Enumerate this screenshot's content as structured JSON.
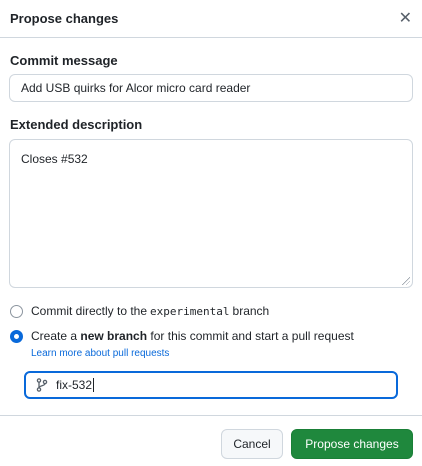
{
  "dialog": {
    "title": "Propose changes",
    "close_icon": "close-icon"
  },
  "commit": {
    "label": "Commit message",
    "value": "Add USB quirks for Alcor micro card reader"
  },
  "description": {
    "label": "Extended description",
    "value": "Closes #532"
  },
  "options": {
    "direct": {
      "prefix": "Commit directly to the",
      "branch": "experimental",
      "suffix": "branch",
      "checked": false
    },
    "new_branch": {
      "prefix": "Create a",
      "bold": "new branch",
      "suffix": "for this commit and start a pull request",
      "checked": true
    },
    "learn_more": "Learn more about pull requests"
  },
  "branch_input": {
    "icon": "git-branch-icon",
    "value": "fix-532"
  },
  "buttons": {
    "cancel": "Cancel",
    "propose": "Propose changes"
  },
  "colors": {
    "accent": "#0969da",
    "primary": "#1f883d"
  }
}
